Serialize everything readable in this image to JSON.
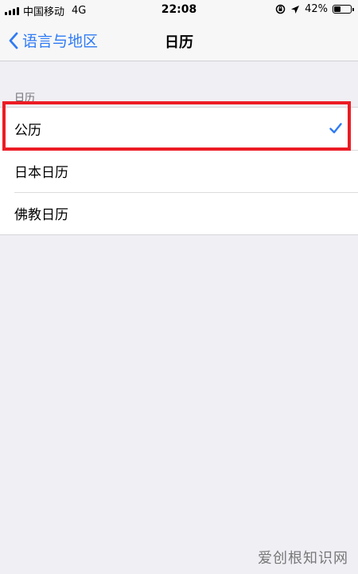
{
  "status_bar": {
    "carrier": "中国移动",
    "network": "4G",
    "time": "22:08",
    "battery_percent": "42%",
    "battery_level": 0.42,
    "icons": [
      "signal-icon",
      "orientation-lock-icon",
      "location-icon",
      "battery-icon"
    ]
  },
  "nav": {
    "back_label": "语言与地区",
    "title": "日历"
  },
  "section": {
    "header": "日历",
    "items": [
      {
        "label": "公历",
        "selected": true
      },
      {
        "label": "日本日历",
        "selected": false
      },
      {
        "label": "佛教日历",
        "selected": false
      }
    ]
  },
  "watermark": "爱创根知识网",
  "colors": {
    "accent": "#2f7bf5",
    "highlight": "#ec1c24",
    "background": "#efeff4"
  }
}
